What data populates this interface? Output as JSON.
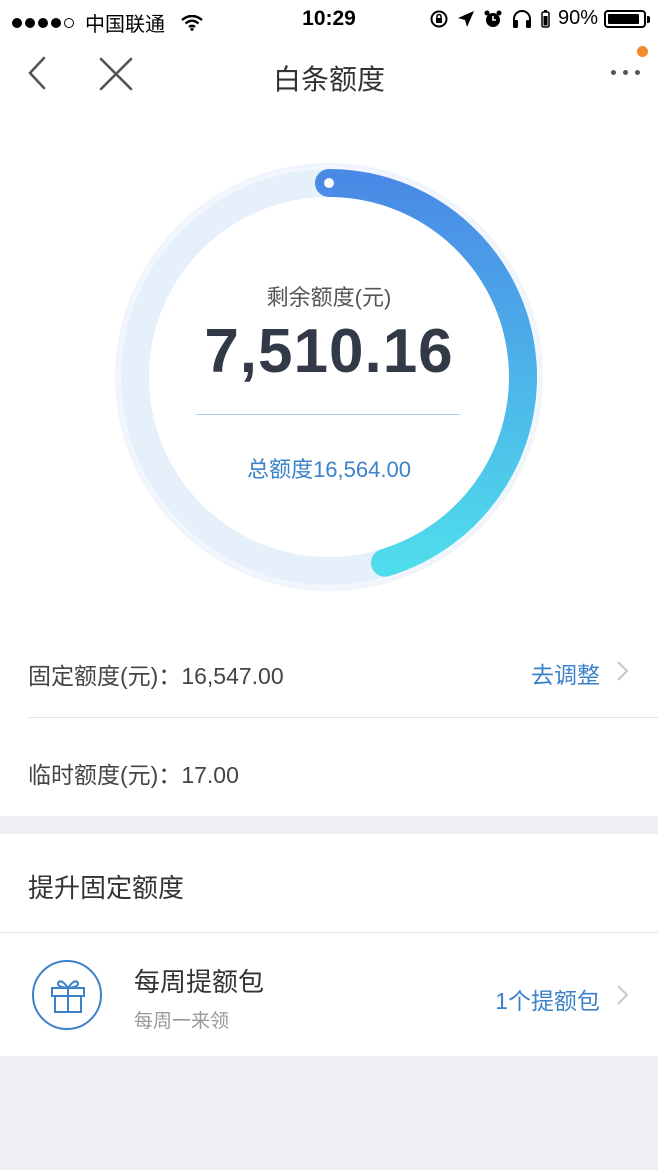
{
  "status_bar": {
    "carrier": "中国联通",
    "time": "10:29",
    "battery": "90%",
    "battery_level": 0.9
  },
  "nav": {
    "title": "白条额度",
    "icons": [
      "back-chevron-icon",
      "close-icon",
      "more-dots-icon"
    ],
    "badge_color": "#f08a2a"
  },
  "quota": {
    "remaining_label": "剩余额度(元)",
    "remaining_value": "7,510.16",
    "total_text": "总额度16,564.00",
    "remaining_fraction": 0.4534,
    "ring_colors": {
      "start": "#4a8ae6",
      "end": "#4fdcec",
      "track": "#e6f0fb"
    }
  },
  "limits": {
    "fixed_label": "固定额度(元)：16,547.00",
    "fixed_action": "去调整",
    "temp_label": "临时额度(元)：17.00"
  },
  "boost": {
    "title": "提升固定额度",
    "package_name": "每周提额包",
    "package_sub": "每周一来领",
    "package_count": "1个提额包",
    "icon": "gift-icon"
  },
  "colors": {
    "accent": "#3c82c9",
    "background": "#efeff4"
  }
}
